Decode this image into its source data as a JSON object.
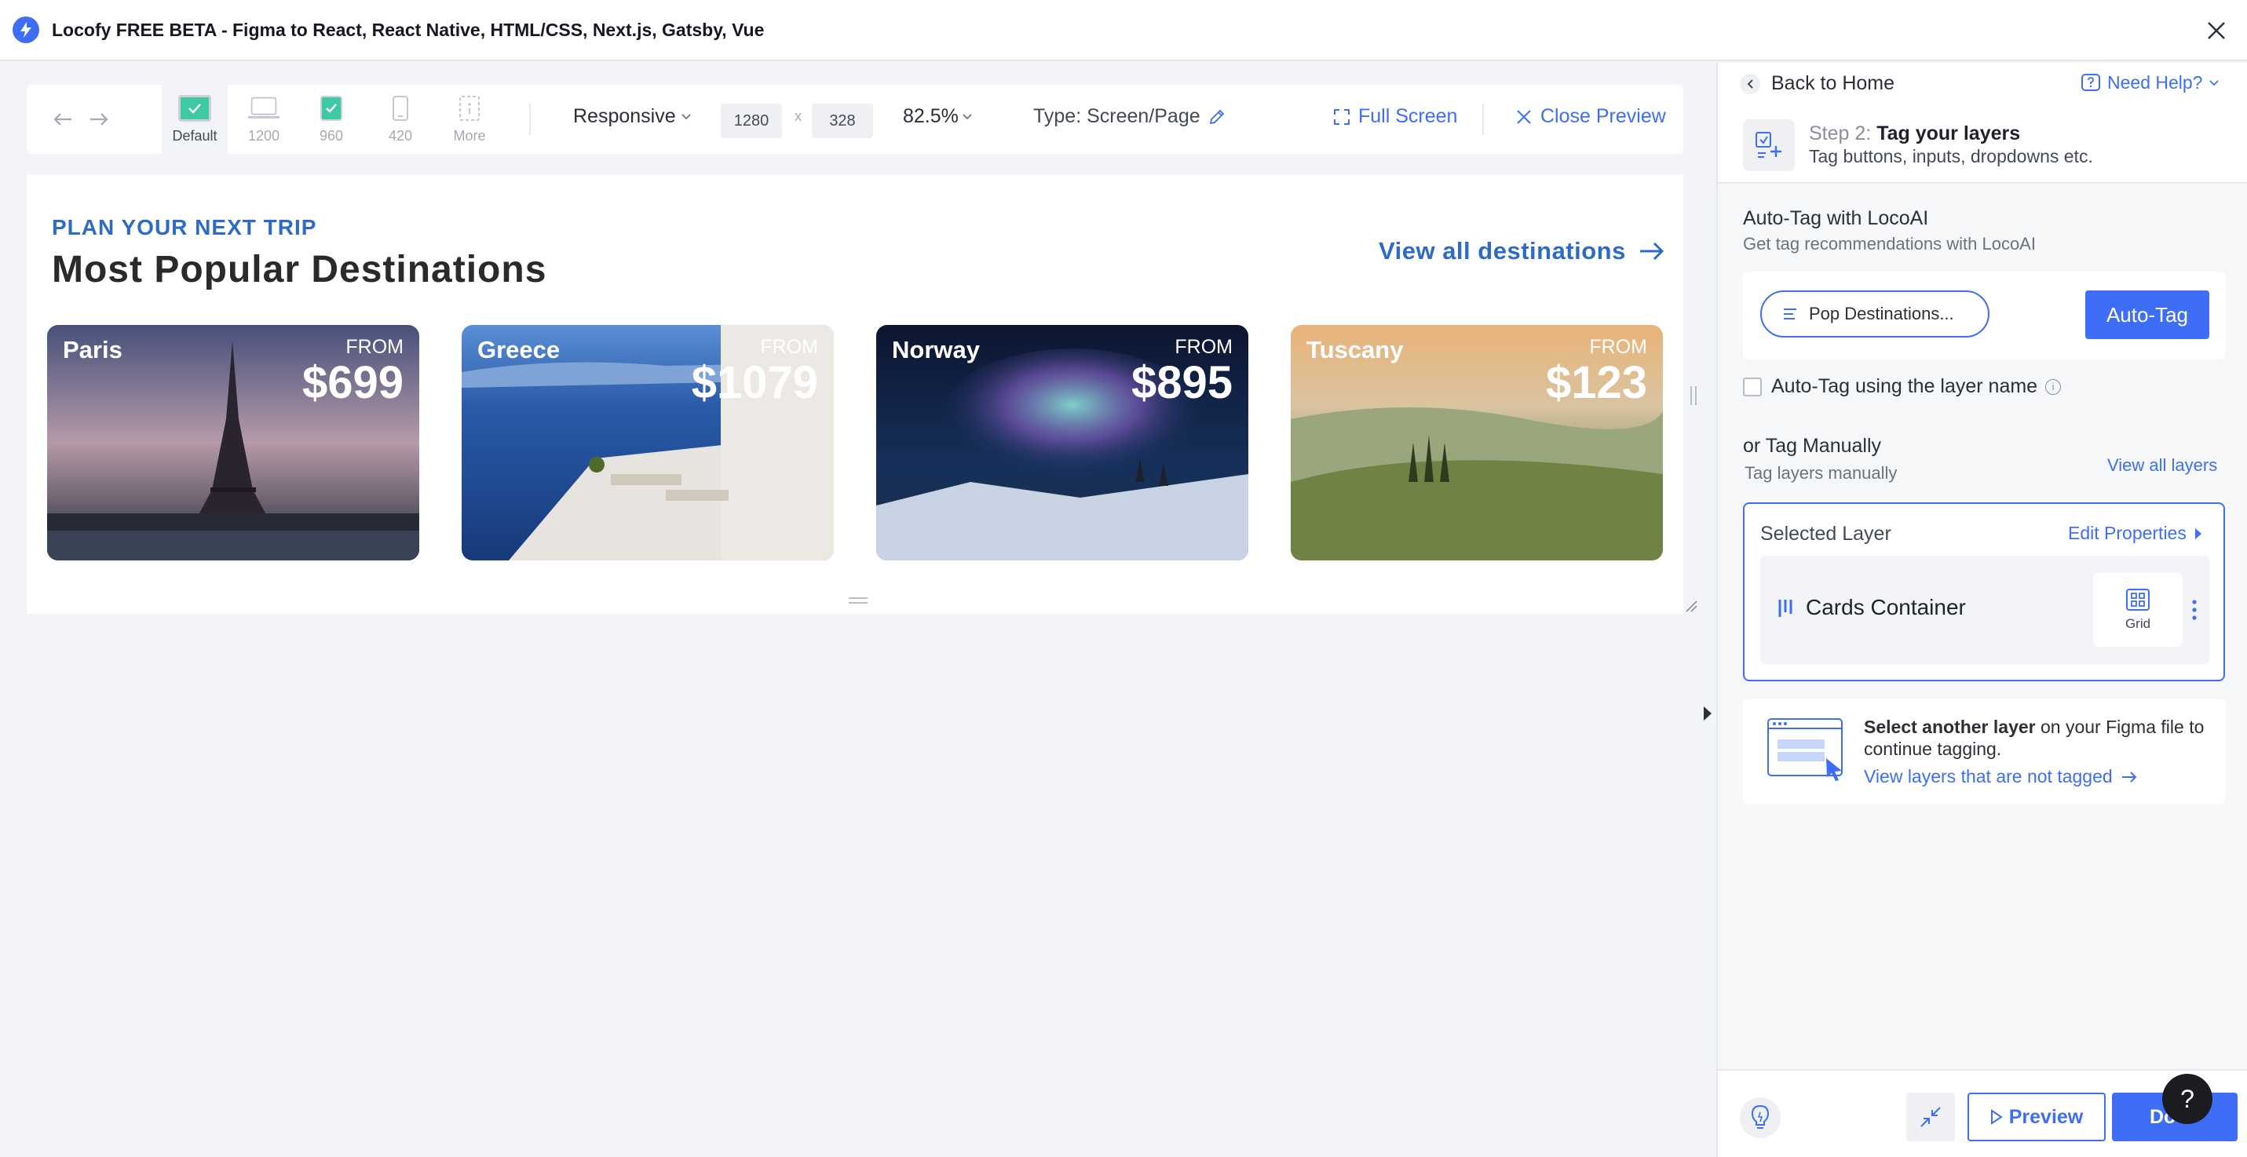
{
  "window": {
    "title": "Locofy FREE BETA - Figma to React, React Native, HTML/CSS, Next.js, Gatsby, Vue"
  },
  "toolbar": {
    "devices": [
      {
        "label": "Default",
        "icon": "checked-screen-icon",
        "active": true
      },
      {
        "label": "1200",
        "icon": "laptop-icon",
        "active": false
      },
      {
        "label": "960",
        "icon": "checked-tablet-icon",
        "active": false
      },
      {
        "label": "420",
        "icon": "phone-icon",
        "active": false
      },
      {
        "label": "More",
        "icon": "more-devices-icon",
        "active": false
      }
    ],
    "mode": "Responsive",
    "width": "1280",
    "x_sep": "x",
    "height": "328",
    "zoom": "82.5%",
    "type_label": "Type: Screen/Page",
    "full_screen": "Full Screen",
    "close_preview": "Close Preview"
  },
  "preview": {
    "eyebrow": "PLAN YOUR NEXT TRIP",
    "heading": "Most Popular Destinations",
    "view_all": "View all destinations",
    "cards": [
      {
        "name": "Paris",
        "from": "FROM",
        "price": "$699"
      },
      {
        "name": "Greece",
        "from": "FROM",
        "price": "$1079"
      },
      {
        "name": "Norway",
        "from": "FROM",
        "price": "$895"
      },
      {
        "name": "Tuscany",
        "from": "FROM",
        "price": "$123"
      }
    ]
  },
  "panel": {
    "back_home": "Back to Home",
    "need_help": "Need Help?",
    "step_prefix": "Step 2:",
    "step_title": "Tag your layers",
    "step_sub": "Tag buttons, inputs, dropdowns etc.",
    "autotag_title": "Auto-Tag with LocoAI",
    "autotag_sub": "Get tag recommendations with LocoAI",
    "pill_label": "Pop Destinations...",
    "autotag_button": "Auto-Tag",
    "autotag_layer_name": "Auto-Tag using the layer name",
    "info_glyph": "i",
    "manual_title": "or Tag Manually",
    "manual_sub": "Tag layers manually",
    "view_all_layers": "View all layers",
    "selected_layer_label": "Selected Layer",
    "edit_properties": "Edit Properties",
    "layer_name": "Cards Container",
    "layer_tag": "Grid",
    "another_bold": "Select another layer",
    "another_rest": " on your Figma file to continue tagging.",
    "another_link": "View layers that are not tagged",
    "preview_button": "Preview",
    "done_button": "Do",
    "help_glyph": "?"
  },
  "colors": {
    "accent": "#3d6ef5",
    "link_blue": "#2e6bc5"
  }
}
